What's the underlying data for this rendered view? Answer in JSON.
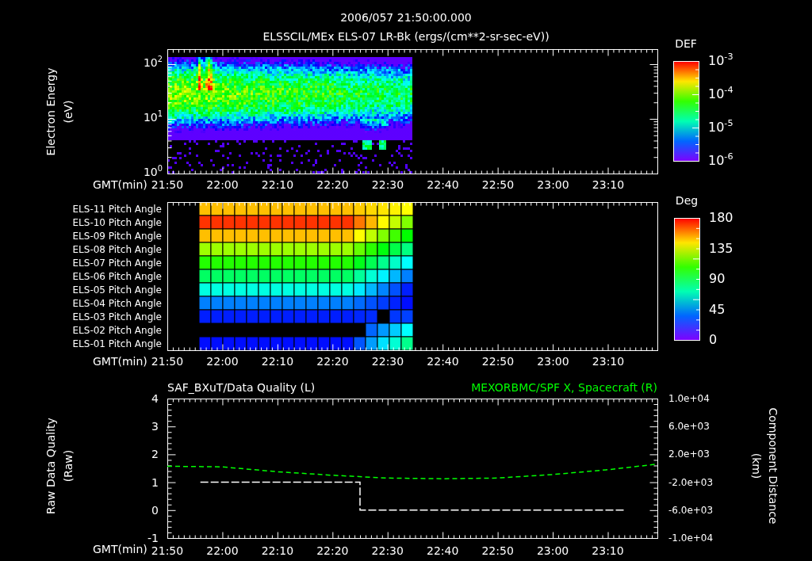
{
  "header": {
    "time": "2006/057 21:50:00.000"
  },
  "panels": [
    {
      "kind": "spectrogram",
      "title": "ELSSCIL/MEx ELS-07 LR-Bk  (ergs/(cm**2-sr-sec-eV))",
      "ylabel": "Electron Energy",
      "yunit": "(eV)",
      "yticks": [
        "10$^{2}$",
        "10$^{1}$",
        "10$^{0}$"
      ],
      "xlabel": "GMT(min)",
      "xticks": [
        "21:50",
        "22:00",
        "22:10",
        "22:20",
        "22:30",
        "22:40",
        "22:50",
        "23:00",
        "23:10"
      ],
      "colorbar": {
        "title": "DEF",
        "ticks": [
          "10$^{-3}$",
          "10$^{-4}$",
          "10$^{-5}$",
          "10$^{-6}$"
        ]
      }
    },
    {
      "kind": "pitch_angle",
      "rows": [
        "ELS-11 Pitch Angle",
        "ELS-10 Pitch Angle",
        "ELS-09 Pitch Angle",
        "ELS-08 Pitch Angle",
        "ELS-07 Pitch Angle",
        "ELS-06 Pitch Angle",
        "ELS-05 Pitch Angle",
        "ELS-04 Pitch Angle",
        "ELS-03 Pitch Angle",
        "ELS-02 Pitch Angle",
        "ELS-01 Pitch Angle"
      ],
      "xlabel": "GMT(min)",
      "xticks": [
        "21:50",
        "22:00",
        "22:10",
        "22:20",
        "22:30",
        "22:40",
        "22:50",
        "23:00",
        "23:10"
      ],
      "colorbar": {
        "title": "Deg",
        "ticks": [
          "180",
          "135",
          "90",
          "45",
          "0"
        ]
      }
    },
    {
      "kind": "line_plot",
      "xlabel": "GMT(min)",
      "yunit": "(Raw)",
      "y2unit": "(km)",
      "charts": [
        {
          "chart_data": {
            "type": "line",
            "title": "SAF_BXuT/Data Quality (L)",
            "ylabel": "Raw Data Quality",
            "x": [
              1316,
              1345,
              1345,
              1393
            ],
            "series": [
              {
                "color": "#ffffff",
                "line_style": "dashed",
                "values": [
                  1,
                  1,
                  0,
                  0
                ]
              }
            ],
            "xlim": [
              1310,
              1399
            ],
            "ylim": [
              -1,
              4
            ],
            "xticks": [
              {
                "value": 1310,
                "label": "21:50"
              },
              {
                "value": 1320,
                "label": "22:00"
              },
              {
                "value": 1330,
                "label": "22:10"
              },
              {
                "value": 1340,
                "label": "22:20"
              },
              {
                "value": 1350,
                "label": "22:30"
              },
              {
                "value": 1360,
                "label": "22:40"
              },
              {
                "value": 1370,
                "label": "22:50"
              },
              {
                "value": 1380,
                "label": "23:00"
              },
              {
                "value": 1390,
                "label": "23:10"
              }
            ],
            "yticks": [
              4,
              3,
              2,
              1,
              0,
              -1
            ]
          }
        },
        {
          "chart_data": {
            "type": "line",
            "title": "MEXORBMC/SPF X, Spacecraft (R)",
            "ylabel": "Component Distance",
            "x": [
              1310,
              1320,
              1330,
              1340,
              1350,
              1360,
              1370,
              1380,
              1390,
              1399
            ],
            "series": [
              {
                "color": "#00ff00",
                "line_style": "dashed",
                "values": [
                  300,
                  200,
                  -500,
                  -1000,
                  -1400,
                  -1500,
                  -1400,
                  -900,
                  -200,
                  600
                ]
              }
            ],
            "xlim": [
              1310,
              1399
            ],
            "ylim": [
              -10000,
              10000
            ],
            "yticks": [
              {
                "value": 10000,
                "label": "1.0e+04"
              },
              {
                "value": 6000,
                "label": "6.0e+03"
              },
              {
                "value": 2000,
                "label": "2.0e+03"
              },
              {
                "value": -2000,
                "label": "-2.0e+03"
              },
              {
                "value": -6000,
                "label": "-6.0e+03"
              },
              {
                "value": -10000,
                "label": "-1.0e+04"
              }
            ]
          }
        }
      ]
    }
  ]
}
